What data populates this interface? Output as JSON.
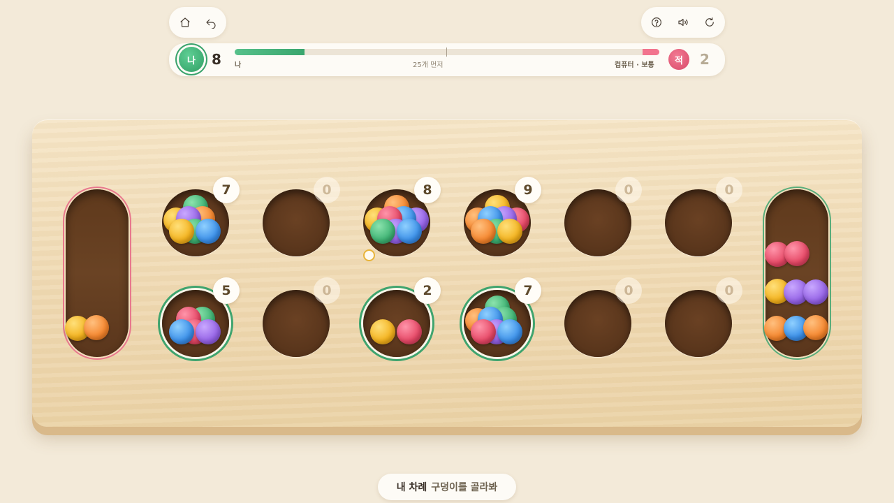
{
  "toolbar": {
    "left_icons": [
      "home-icon",
      "undo-icon"
    ],
    "right_icons": [
      "help-icon",
      "sound-icon",
      "restart-icon"
    ]
  },
  "scoreboard": {
    "player": {
      "avatar": "나",
      "score": "8",
      "label": "나",
      "color": "#3aa66e"
    },
    "opponent": {
      "avatar": "적",
      "score": "2",
      "label": "컴퓨터 · 보통",
      "color": "#e64866"
    },
    "goal_label": "25개 먼저",
    "player_progress": 0.165,
    "opponent_progress": 0.04
  },
  "board": {
    "top_row": [
      {
        "count": "7",
        "seeds": [
          "yellow",
          "green",
          "orange",
          "purple",
          "green",
          "blue",
          "yellow"
        ]
      },
      {
        "count": "0",
        "seeds": []
      },
      {
        "count": "8",
        "seeds": [
          "purple",
          "yellow",
          "orange",
          "blue",
          "red",
          "purple",
          "blue",
          "green"
        ]
      },
      {
        "count": "9",
        "seeds": [
          "green",
          "red",
          "orange",
          "yellow",
          "purple",
          "blue",
          "green",
          "yellow",
          "orange"
        ]
      },
      {
        "count": "0",
        "seeds": []
      },
      {
        "count": "0",
        "seeds": []
      }
    ],
    "bottom_row": [
      {
        "count": "5",
        "seeds": [
          "green",
          "red",
          "red",
          "purple",
          "blue"
        ],
        "selectable": true
      },
      {
        "count": "0",
        "seeds": []
      },
      {
        "count": "2",
        "seeds": [
          "red",
          "yellow"
        ],
        "selectable": true
      },
      {
        "count": "7",
        "seeds": [
          "orange",
          "green",
          "green",
          "blue",
          "purple",
          "blue",
          "red"
        ],
        "selectable": true
      },
      {
        "count": "0",
        "seeds": []
      },
      {
        "count": "0",
        "seeds": []
      }
    ],
    "left_store": {
      "seeds": [
        "yellow",
        "orange"
      ]
    },
    "right_store": {
      "seeds": [
        "red",
        "red",
        "yellow",
        "purple",
        "purple",
        "orange",
        "blue",
        "orange"
      ]
    }
  },
  "status": {
    "bold": "내 차례",
    "text": "구덩이를 골라봐"
  }
}
